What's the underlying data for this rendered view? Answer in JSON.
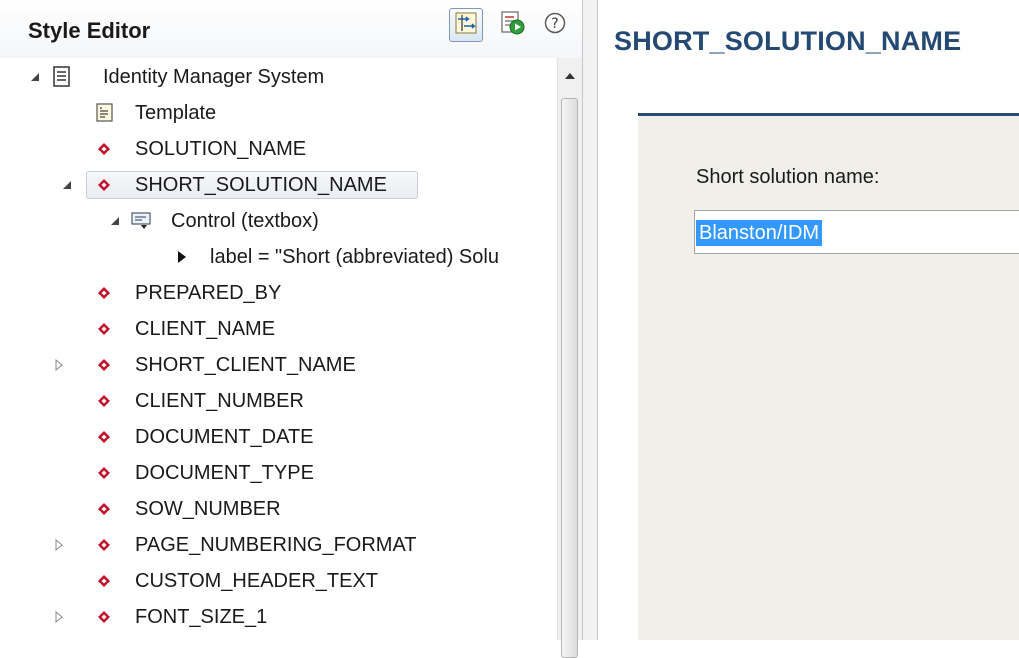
{
  "style_editor": {
    "title": "Style Editor",
    "toolbar": {
      "link_icon": "link-with-editor-icon",
      "run_icon": "run-preview-icon",
      "help_icon": "help-icon"
    },
    "tree": {
      "root": "Identity Manager System",
      "template": "Template",
      "solution_name": "SOLUTION_NAME",
      "short_solution_name": "SHORT_SOLUTION_NAME",
      "control": "Control (textbox)",
      "label_property": "label = \"Short (abbreviated) Solu",
      "prepared_by": "PREPARED_BY",
      "client_name": "CLIENT_NAME",
      "short_client_name": "SHORT_CLIENT_NAME",
      "client_number": "CLIENT_NUMBER",
      "document_date": "DOCUMENT_DATE",
      "document_type": "DOCUMENT_TYPE",
      "sow_number": "SOW_NUMBER",
      "page_numbering_format": "PAGE_NUMBERING_FORMAT",
      "custom_header_text": "CUSTOM_HEADER_TEXT",
      "font_size_1": "FONT_SIZE_1"
    }
  },
  "form": {
    "title": "SHORT_SOLUTION_NAME",
    "field_label": "Short solution name:",
    "field_value": "Blanston/IDM"
  },
  "colors": {
    "accent": "#244a73",
    "selection": "#3399ff",
    "diamond": "#c0102a",
    "form_background": "#f0efea"
  }
}
